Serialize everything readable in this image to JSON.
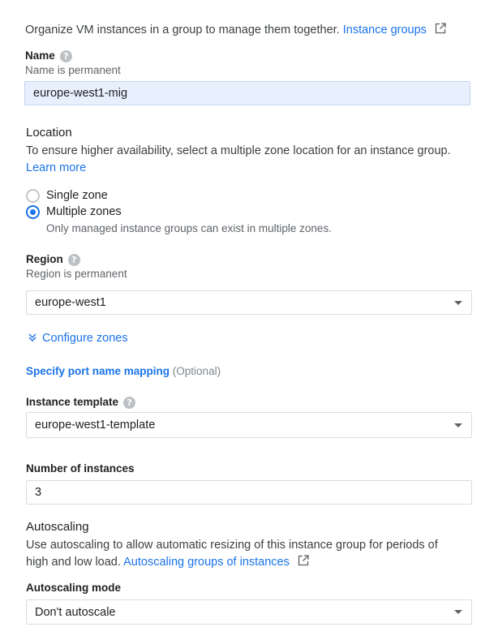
{
  "intro": {
    "text": "Organize VM instances in a group to manage them together.",
    "link": "Instance groups"
  },
  "name_field": {
    "label": "Name",
    "hint": "Name is permanent",
    "value": "europe-west1-mig"
  },
  "location": {
    "title": "Location",
    "description": "To ensure higher availability, select a multiple zone location for an instance group.",
    "learn_more": "Learn more",
    "options": [
      {
        "label": "Single zone",
        "selected": false
      },
      {
        "label": "Multiple zones",
        "selected": true
      }
    ],
    "multi_note": "Only managed instance groups can exist in multiple zones."
  },
  "region": {
    "label": "Region",
    "hint": "Region is permanent",
    "value": "europe-west1"
  },
  "configure_zones": "Configure zones",
  "port_mapping": {
    "link": "Specify port name mapping",
    "optional": "(Optional)"
  },
  "instance_template": {
    "label": "Instance template",
    "value": "europe-west1-template"
  },
  "num_instances": {
    "label": "Number of instances",
    "value": "3"
  },
  "autoscaling": {
    "title": "Autoscaling",
    "description_line1": "Use autoscaling to allow automatic resizing of this instance group for periods of",
    "description_line2": "high and low load.",
    "link": "Autoscaling groups of instances",
    "mode_label": "Autoscaling mode",
    "mode_value": "Don't autoscale"
  },
  "colors": {
    "accent": "#1a73e8",
    "filled_input": "#e8f0fe"
  }
}
